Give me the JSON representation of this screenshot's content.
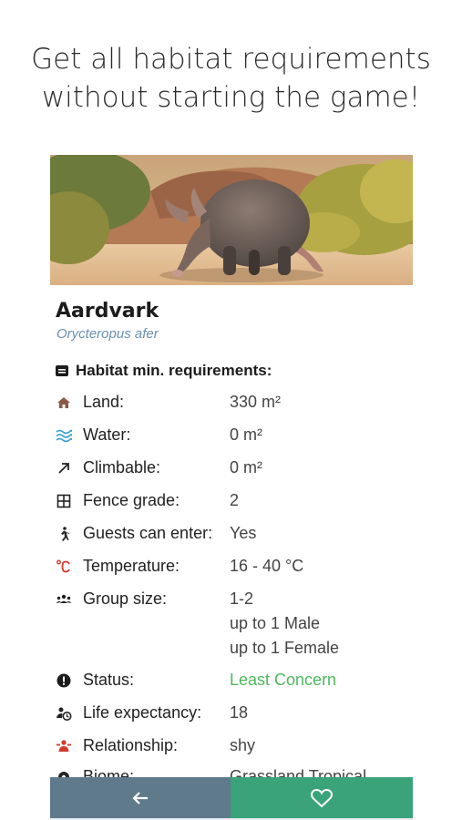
{
  "headline": {
    "line1": "Get all habitat requirements",
    "line2": "without starting the game!"
  },
  "animal": {
    "name": "Aardvark",
    "scientific_name": "Orycteropus afer"
  },
  "requirements": {
    "title": "Habitat min. requirements:",
    "rows": [
      {
        "icon": "home-icon",
        "label": "Land:",
        "value": "330 m²"
      },
      {
        "icon": "water-waves-icon",
        "label": "Water:",
        "value": "0 m²"
      },
      {
        "icon": "climb-arrow-icon",
        "label": "Climbable:",
        "value": "0 m²"
      },
      {
        "icon": "fence-grid-icon",
        "label": "Fence grade:",
        "value": "2"
      },
      {
        "icon": "running-person-icon",
        "label": "Guests can enter:",
        "value": "Yes"
      },
      {
        "icon": "temperature-icon",
        "label": "Temperature:",
        "value": "16 - 40 °C"
      },
      {
        "icon": "group-icon",
        "label": "Group size:",
        "value_lines": [
          "1-2",
          "up to 1 Male",
          "up to 1 Female"
        ]
      },
      {
        "icon": "alert-circle-icon",
        "label": "Status:",
        "value": "Least Concern"
      },
      {
        "icon": "life-expectancy-icon",
        "label": "Life expectancy:",
        "value": "18"
      },
      {
        "icon": "relationship-icon",
        "label": "Relationship:",
        "value": "shy"
      },
      {
        "icon": "biome-icon",
        "label": "Biome:",
        "value": "Grassland Tropical"
      }
    ]
  },
  "nav": {
    "back_icon": "arrow-left-icon",
    "favorite_icon": "heart-outline-icon"
  },
  "colors": {
    "scientific_name": "#6a8fb0",
    "status_green": "#4cb85c",
    "back_button": "#5f7a8a",
    "favorite_button": "#3aa37a",
    "water_icon": "#3aa0d8",
    "temperature_icon": "#d23b2b",
    "relationship_icon": "#d23b2b"
  }
}
